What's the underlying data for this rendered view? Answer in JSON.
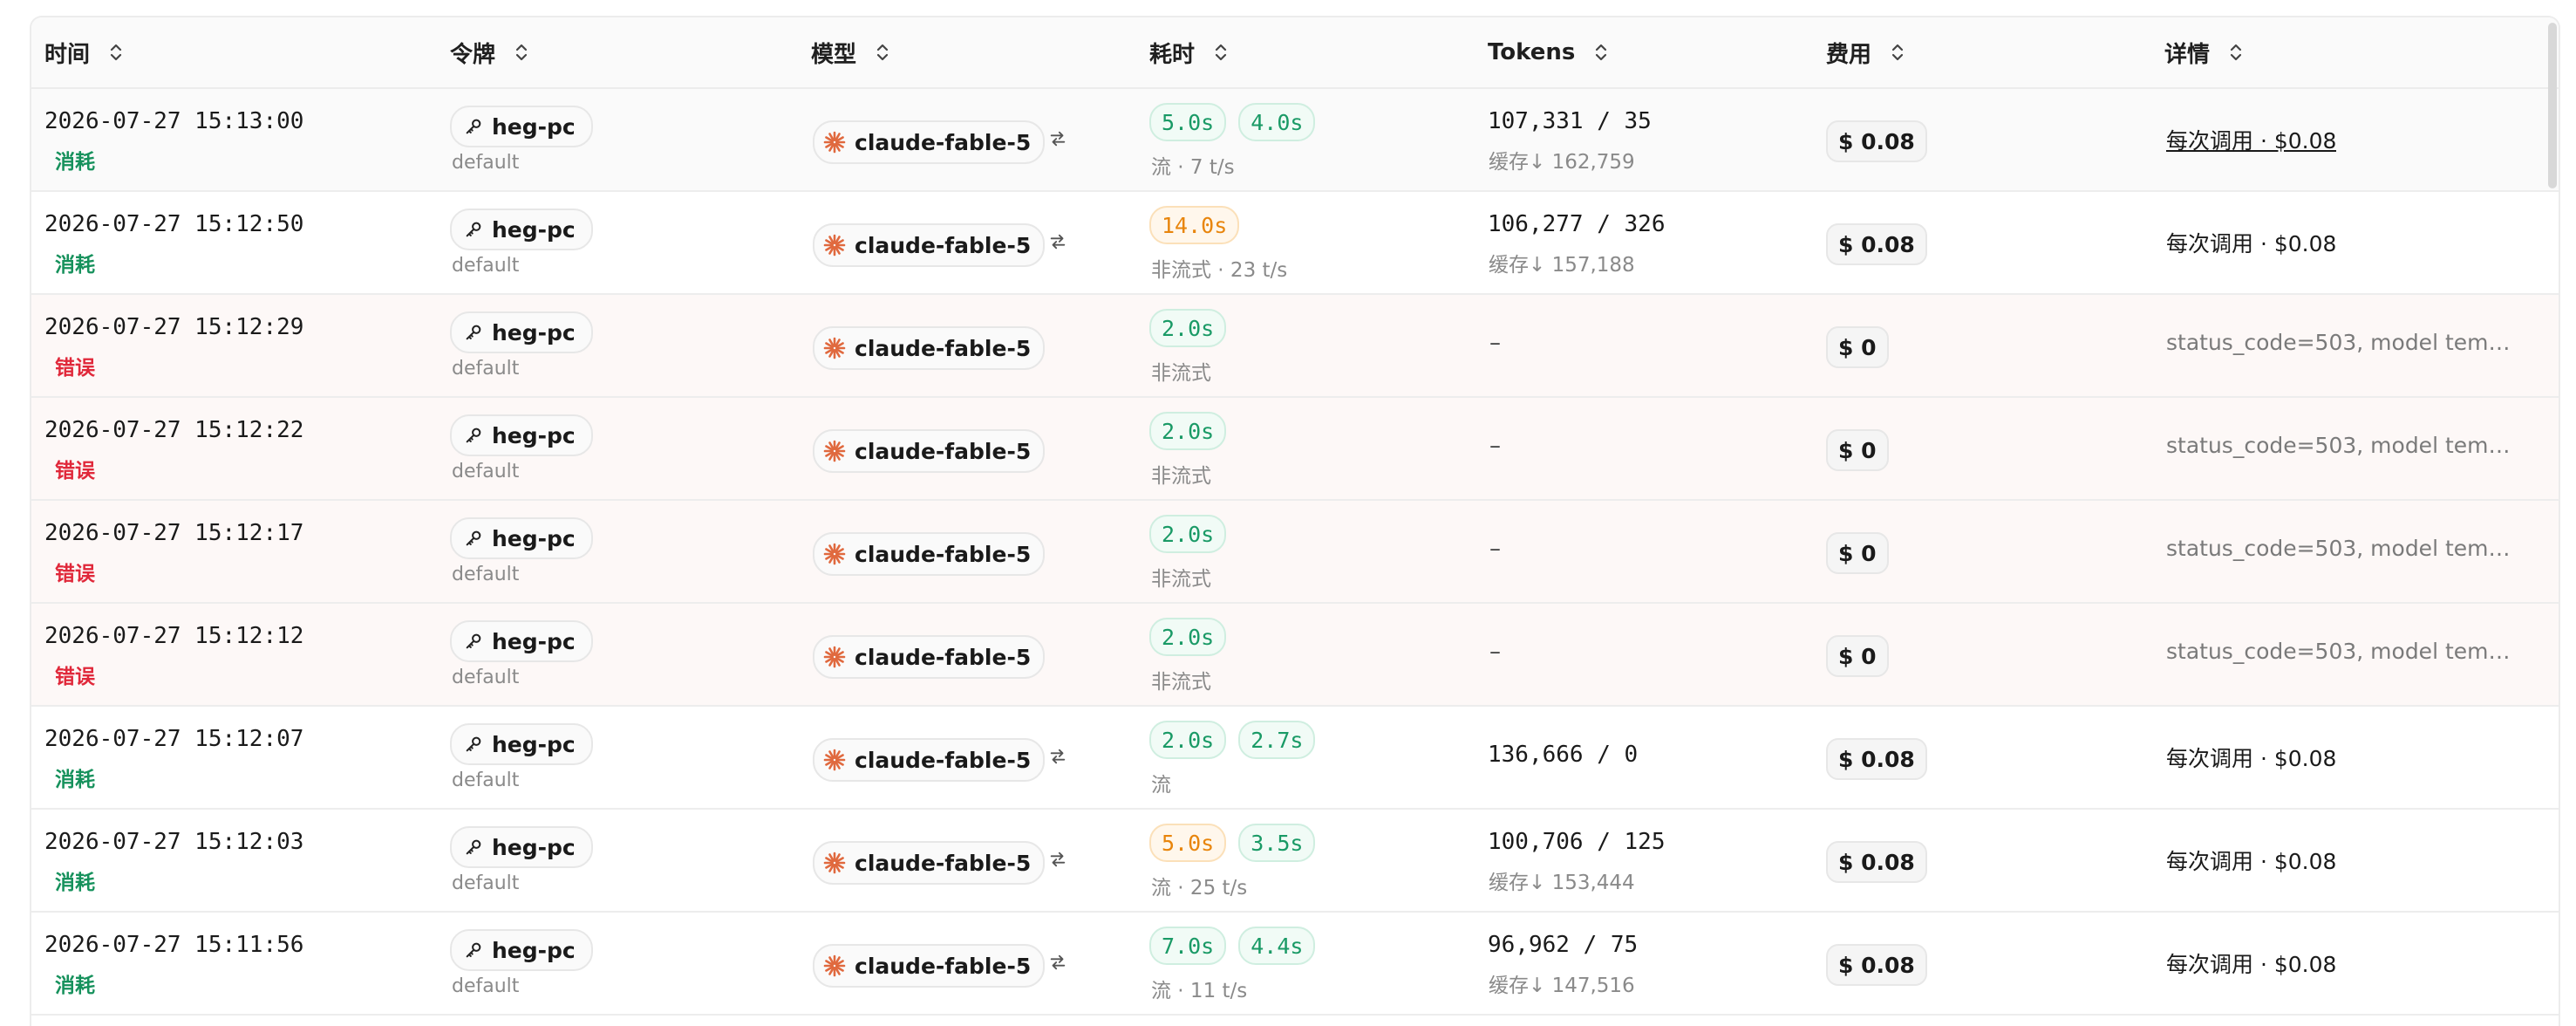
{
  "columns": [
    {
      "label": "时间"
    },
    {
      "label": "令牌"
    },
    {
      "label": "模型"
    },
    {
      "label": "耗时"
    },
    {
      "label": "Tokens"
    },
    {
      "label": "费用"
    },
    {
      "label": "详情"
    }
  ],
  "colors": {
    "success": "#16915c",
    "error": "#e0283a",
    "fast_tag": "#1a9a66",
    "slow_tag": "#e8850c",
    "model_icon": "#e0693e"
  },
  "rows": [
    {
      "time": "2026-07-27 15:13:00",
      "status": "消耗",
      "status_type": "ok",
      "token": "heg-pc",
      "group": "default",
      "model": "claude-fable-5",
      "has_switch": true,
      "durations": [
        {
          "v": "5.0s",
          "c": "green"
        },
        {
          "v": "4.0s",
          "c": "green"
        }
      ],
      "stream": "流 · 7 t/s",
      "tokens": "107,331 / 35",
      "cache": "缓存↓ 162,759",
      "cost": "$ 0.08",
      "detail": "每次调用 · $0.08",
      "detail_type": "link",
      "row_type": "hl"
    },
    {
      "time": "2026-07-27 15:12:50",
      "status": "消耗",
      "status_type": "ok",
      "token": "heg-pc",
      "group": "default",
      "model": "claude-fable-5",
      "has_switch": true,
      "durations": [
        {
          "v": "14.0s",
          "c": "orange"
        }
      ],
      "stream": "非流式 · 23 t/s",
      "tokens": "106,277 / 326",
      "cache": "缓存↓ 157,188",
      "cost": "$ 0.08",
      "detail": "每次调用 · $0.08",
      "detail_type": "normal",
      "row_type": "normal"
    },
    {
      "time": "2026-07-27 15:12:29",
      "status": "错误",
      "status_type": "bad",
      "token": "heg-pc",
      "group": "default",
      "model": "claude-fable-5",
      "has_switch": false,
      "durations": [
        {
          "v": "2.0s",
          "c": "green"
        }
      ],
      "stream": "非流式",
      "tokens": "–",
      "cache": "",
      "cost": "$ 0",
      "detail": "status_code=503, model temp...",
      "detail_type": "err",
      "row_type": "err"
    },
    {
      "time": "2026-07-27 15:12:22",
      "status": "错误",
      "status_type": "bad",
      "token": "heg-pc",
      "group": "default",
      "model": "claude-fable-5",
      "has_switch": false,
      "durations": [
        {
          "v": "2.0s",
          "c": "green"
        }
      ],
      "stream": "非流式",
      "tokens": "–",
      "cache": "",
      "cost": "$ 0",
      "detail": "status_code=503, model temp...",
      "detail_type": "err",
      "row_type": "err"
    },
    {
      "time": "2026-07-27 15:12:17",
      "status": "错误",
      "status_type": "bad",
      "token": "heg-pc",
      "group": "default",
      "model": "claude-fable-5",
      "has_switch": false,
      "durations": [
        {
          "v": "2.0s",
          "c": "green"
        }
      ],
      "stream": "非流式",
      "tokens": "–",
      "cache": "",
      "cost": "$ 0",
      "detail": "status_code=503, model temp...",
      "detail_type": "err",
      "row_type": "err"
    },
    {
      "time": "2026-07-27 15:12:12",
      "status": "错误",
      "status_type": "bad",
      "token": "heg-pc",
      "group": "default",
      "model": "claude-fable-5",
      "has_switch": false,
      "durations": [
        {
          "v": "2.0s",
          "c": "green"
        }
      ],
      "stream": "非流式",
      "tokens": "–",
      "cache": "",
      "cost": "$ 0",
      "detail": "status_code=503, model temp...",
      "detail_type": "err",
      "row_type": "err"
    },
    {
      "time": "2026-07-27 15:12:07",
      "status": "消耗",
      "status_type": "ok",
      "token": "heg-pc",
      "group": "default",
      "model": "claude-fable-5",
      "has_switch": true,
      "durations": [
        {
          "v": "2.0s",
          "c": "green"
        },
        {
          "v": "2.7s",
          "c": "green"
        }
      ],
      "stream": "流",
      "tokens": "136,666 / 0",
      "cache": "",
      "cost": "$ 0.08",
      "detail": "每次调用 · $0.08",
      "detail_type": "normal",
      "row_type": "normal"
    },
    {
      "time": "2026-07-27 15:12:03",
      "status": "消耗",
      "status_type": "ok",
      "token": "heg-pc",
      "group": "default",
      "model": "claude-fable-5",
      "has_switch": true,
      "durations": [
        {
          "v": "5.0s",
          "c": "orange"
        },
        {
          "v": "3.5s",
          "c": "green"
        }
      ],
      "stream": "流 · 25 t/s",
      "tokens": "100,706 / 125",
      "cache": "缓存↓ 153,444",
      "cost": "$ 0.08",
      "detail": "每次调用 · $0.08",
      "detail_type": "normal",
      "row_type": "normal"
    },
    {
      "time": "2026-07-27 15:11:56",
      "status": "消耗",
      "status_type": "ok",
      "token": "heg-pc",
      "group": "default",
      "model": "claude-fable-5",
      "has_switch": true,
      "durations": [
        {
          "v": "7.0s",
          "c": "green"
        },
        {
          "v": "4.4s",
          "c": "green"
        }
      ],
      "stream": "流 · 11 t/s",
      "tokens": "96,962 / 75",
      "cache": "缓存↓ 147,516",
      "cost": "$ 0.08",
      "detail": "每次调用 · $0.08",
      "detail_type": "normal",
      "row_type": "normal"
    }
  ]
}
